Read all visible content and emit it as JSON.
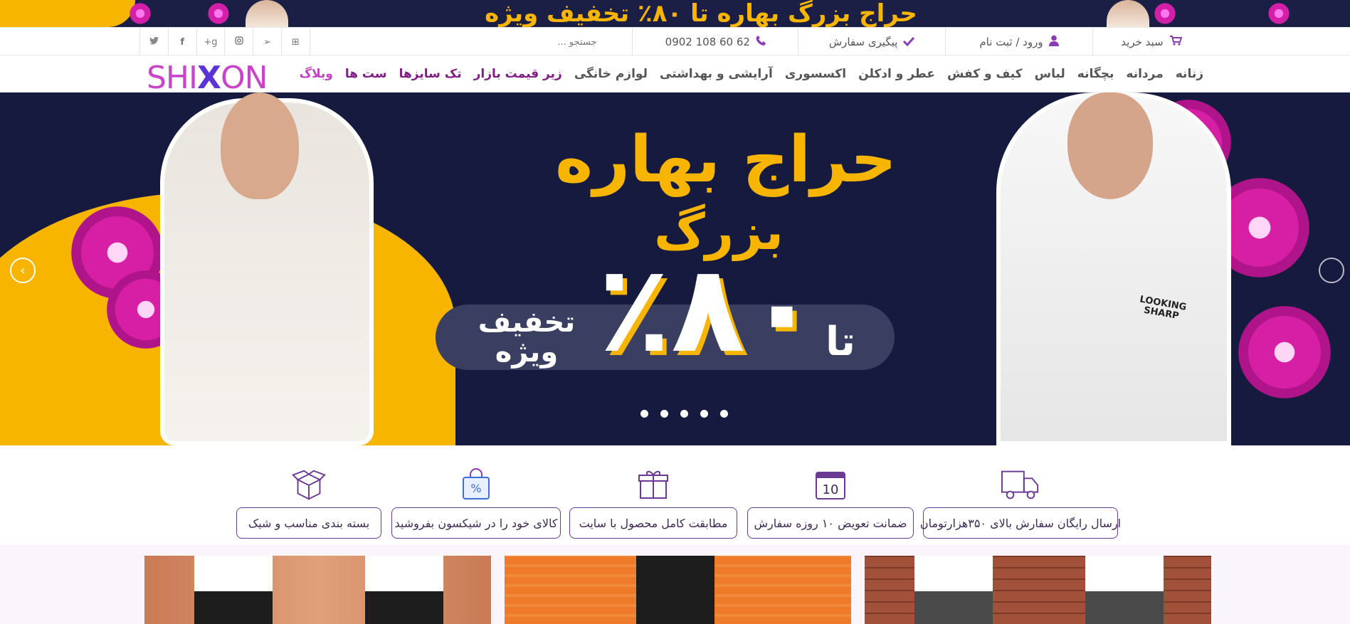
{
  "promo_strip": {
    "text": "حراج بزرگ بهاره تا ۸۰٪ تخفیف ویژه"
  },
  "util_bar": {
    "cart": "سبد خرید",
    "login": "ورود / ثبت نام",
    "track": "پیگیری سفارش",
    "phone": "0902 108 60 62",
    "search_placeholder": "جستجو ..."
  },
  "social_icons": [
    "windows-icon",
    "telegram-icon",
    "instagram-icon",
    "google-plus-icon",
    "facebook-icon",
    "twitter-icon"
  ],
  "logo": {
    "pre": "SHI",
    "x": "X",
    "post": "ON"
  },
  "nav": {
    "items": [
      "زنانه",
      "مردانه",
      "بچگانه",
      "لباس",
      "کیف و کفش",
      "عطر و ادکلن",
      "اکسسوری",
      "آرایشی و بهداشتی",
      "لوازم خانگی",
      "زیر قیمت بازار",
      "تک سایزها",
      "ست ها",
      "وبلاگ"
    ]
  },
  "hero": {
    "title_line1": "حراج بهاره",
    "title_line2": "بزرگ",
    "pct": "٪۸۰",
    "pill_left": "تخفیف ویژه",
    "pill_right": "تا",
    "tshirt_text": "LOOKING SHARP",
    "slide_count": 5
  },
  "features": [
    {
      "label": "ارسال رایگان سفارش بالای ۳۵۰هزارتومان",
      "icon": "delivery-truck-icon"
    },
    {
      "label": "ضمانت تعویض ۱۰ روزه سفارش",
      "icon": "calendar-icon",
      "icon_text": "10"
    },
    {
      "label": "مطابقت کامل محصول با سایت",
      "icon": "gift-icon"
    },
    {
      "label": "کالای خود را در شیکسون بفروشید",
      "icon": "shopping-bag-icon",
      "icon_text": "%"
    },
    {
      "label": "بسته بندی مناسب و شیک",
      "icon": "package-box-icon"
    }
  ],
  "colors": {
    "brand": "#8b3bb4",
    "navy": "#151a3e",
    "yellow": "#f7b500",
    "pink": "#d61fa5"
  }
}
